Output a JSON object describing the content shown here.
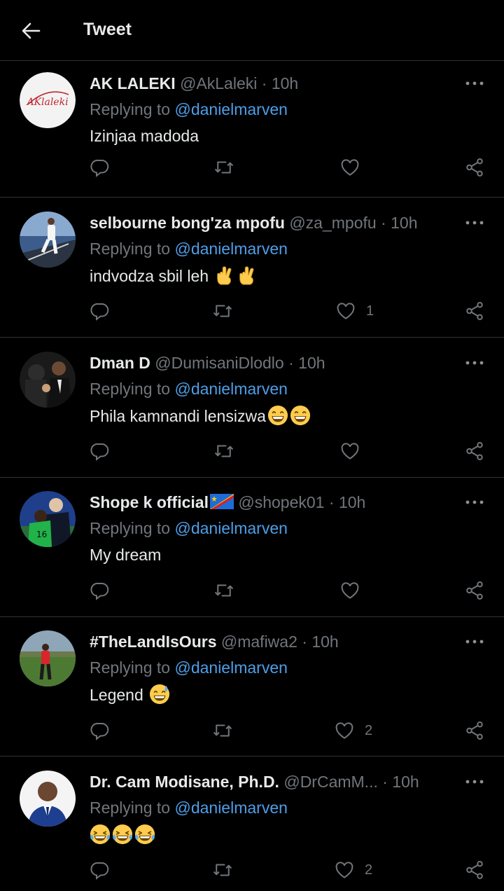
{
  "header": {
    "title": "Tweet"
  },
  "reply_prefix": "Replying to",
  "mention": "@danielmarven",
  "tweets": [
    {
      "name": "AK LALEKI",
      "handle": "@AkLaleki",
      "dot": "·",
      "time": "10h",
      "text": "Izinjaa madoda",
      "likes": "",
      "avatar_logo_text": "AKlaleki"
    },
    {
      "name": "selbourne bong'za mpofu",
      "handle": "@za_mpofu",
      "dot": "·",
      "time": "10h",
      "text": "indvodza sbil leh",
      "likes": "1"
    },
    {
      "name": "Dman D",
      "handle": "@DumisaniDlodlo",
      "dot": "·",
      "time": "10h",
      "text": "Phila kamnandi lensizwa",
      "likes": ""
    },
    {
      "name": "Shope k official",
      "handle": "@shopek01",
      "dot": "·",
      "time": "10h",
      "text": "My dream",
      "likes": ""
    },
    {
      "name": "#TheLandIsOurs",
      "handle": "@mafiwa2",
      "dot": "·",
      "time": "10h",
      "text": "Legend",
      "likes": "2"
    },
    {
      "name": "Dr. Cam Modisane, Ph.D.",
      "handle": "@DrCamM...",
      "dot": "·",
      "time": "10h",
      "text": "",
      "likes": "2"
    }
  ],
  "icons": [
    "back-arrow-icon",
    "more-icon",
    "reply-icon",
    "retweet-icon",
    "like-icon",
    "share-icon",
    "crossed-fingers-emoji",
    "grinning-emoji",
    "sweat-smile-emoji",
    "tears-of-joy-emoji",
    "dr-congo-flag-icon"
  ],
  "colors": {
    "background": "#000000",
    "text": "#e7e9ea",
    "muted": "#71767b",
    "link": "#4e9ee8",
    "divider": "#2f3336"
  }
}
